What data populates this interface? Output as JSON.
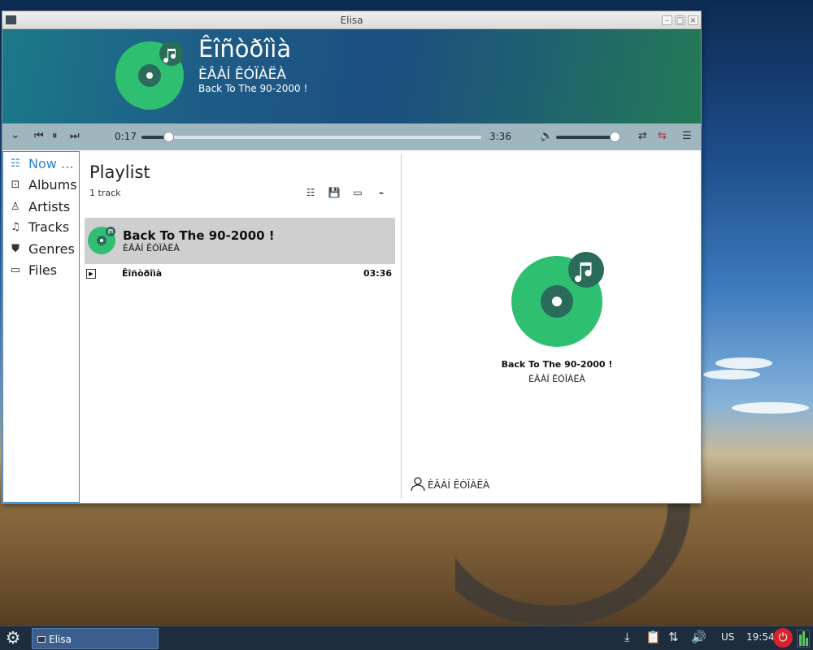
{
  "window": {
    "title": "Elisa"
  },
  "header": {
    "track_title": "Êîñòðîìà",
    "artist": "ÈÂÀÍ ÊÓÏÀËÀ",
    "album": "Back To The 90-2000 !"
  },
  "player": {
    "elapsed": "0:17",
    "duration": "3:36",
    "seek_progress_fraction": 0.08,
    "volume_fraction": 1.0
  },
  "nav": [
    {
      "label": "Now …",
      "icon": "now-playing-list-icon"
    },
    {
      "label": "Albums",
      "icon": "album-icon"
    },
    {
      "label": "Artists",
      "icon": "artist-icon"
    },
    {
      "label": "Tracks",
      "icon": "music-note-icon"
    },
    {
      "label": "Genres",
      "icon": "genre-shield-icon"
    },
    {
      "label": "Files",
      "icon": "folder-icon"
    }
  ],
  "playlist": {
    "title": "Playlist",
    "count": "1 track",
    "album_group": {
      "album": "Back To The 90-2000 !",
      "artist": "ÈÂÀÍ ÊÓÏÀËÀ"
    },
    "tracks": [
      {
        "title": "Êîñòðîìà",
        "duration": "03:36"
      }
    ]
  },
  "context": {
    "album": "Back To The 90-2000 !",
    "artist": "ÈÂÀÍ ÊÓÏÀËÀ",
    "artist_link": "ÈÂÀÍ ÊÓÏÀËÀ"
  },
  "taskbar": {
    "task_label": "Elisa",
    "keyboard_layout": "US",
    "clock": "19:54"
  },
  "colors": {
    "accent": "#2a84d2",
    "cover_green": "#2fbf71",
    "cover_dark": "#2a6b5a"
  }
}
